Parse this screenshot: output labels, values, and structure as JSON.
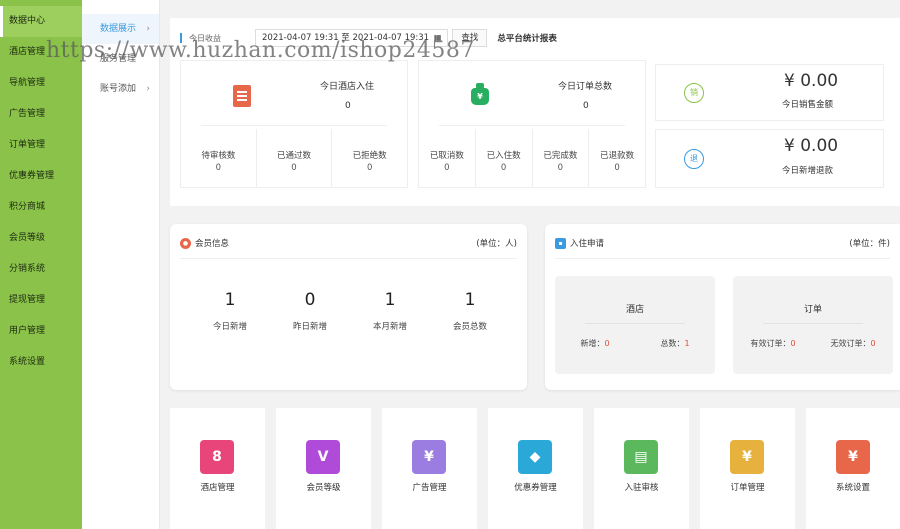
{
  "sidebar": {
    "items": [
      "数据中心",
      "酒店管理",
      "导航管理",
      "广告管理",
      "订单管理",
      "优惠券管理",
      "积分商城",
      "会员等级",
      "分销系统",
      "提现管理",
      "用户管理",
      "系统设置"
    ]
  },
  "submenu": {
    "items": [
      "数据展示",
      "服务管理",
      "账号添加"
    ]
  },
  "toolbar": {
    "label": "今日收益",
    "date_range": "2021-04-07 19:31 至 2021-04-07 19:31",
    "find_button": "查找",
    "report_title": "总平台统计报表"
  },
  "hotel_stats": {
    "title": "今日酒店入住",
    "value": "0",
    "sub": [
      {
        "label": "待审核数",
        "value": "0"
      },
      {
        "label": "已通过数",
        "value": "0"
      },
      {
        "label": "已拒绝数",
        "value": "0"
      }
    ]
  },
  "order_stats": {
    "title": "今日订单总数",
    "icon_glyph": "¥",
    "value": "0",
    "sub": [
      {
        "label": "已取消数",
        "value": "0"
      },
      {
        "label": "已入住数",
        "value": "0"
      },
      {
        "label": "已完成数",
        "value": "0"
      },
      {
        "label": "已退款数",
        "value": "0"
      }
    ]
  },
  "sales": {
    "amount": "¥ 0.00",
    "label": "今日销售金额",
    "icon_char": "销",
    "color": "#8bc34a"
  },
  "refund": {
    "amount": "¥ 0.00",
    "label": "今日新增退款",
    "icon_char": "退",
    "color": "#3a9be0"
  },
  "members": {
    "title": "会员信息",
    "unit": "(单位：人)",
    "stats": [
      {
        "value": "1",
        "label": "今日新增"
      },
      {
        "value": "0",
        "label": "昨日新增"
      },
      {
        "value": "1",
        "label": "本月新增"
      },
      {
        "value": "1",
        "label": "会员总数"
      }
    ]
  },
  "checkin": {
    "title": "入住申请",
    "unit": "(单位：件)",
    "hotel": {
      "title": "酒店",
      "new_label": "新增：",
      "new_value": "0",
      "total_label": "总数：",
      "total_value": "1"
    },
    "order": {
      "title": "订单",
      "valid_label": "有效订单：",
      "valid_value": "0",
      "invalid_label": "无效订单：",
      "invalid_value": "0"
    }
  },
  "tiles": [
    {
      "label": "酒店管理",
      "glyph": "8",
      "color": "#e8457a"
    },
    {
      "label": "会员等级",
      "glyph": "V",
      "color": "#b04ad8"
    },
    {
      "label": "广告管理",
      "glyph": "¥",
      "color": "#9b7ce0"
    },
    {
      "label": "优惠券管理",
      "glyph": "◆",
      "color": "#2aa8d8"
    },
    {
      "label": "入驻审核",
      "glyph": "▤",
      "color": "#5cb85c"
    },
    {
      "label": "订单管理",
      "glyph": "¥",
      "color": "#e6b13c"
    },
    {
      "label": "系统设置",
      "glyph": "¥",
      "color": "#e8674a"
    }
  ],
  "watermark": "https://www.huzhan.com/ishop24587"
}
